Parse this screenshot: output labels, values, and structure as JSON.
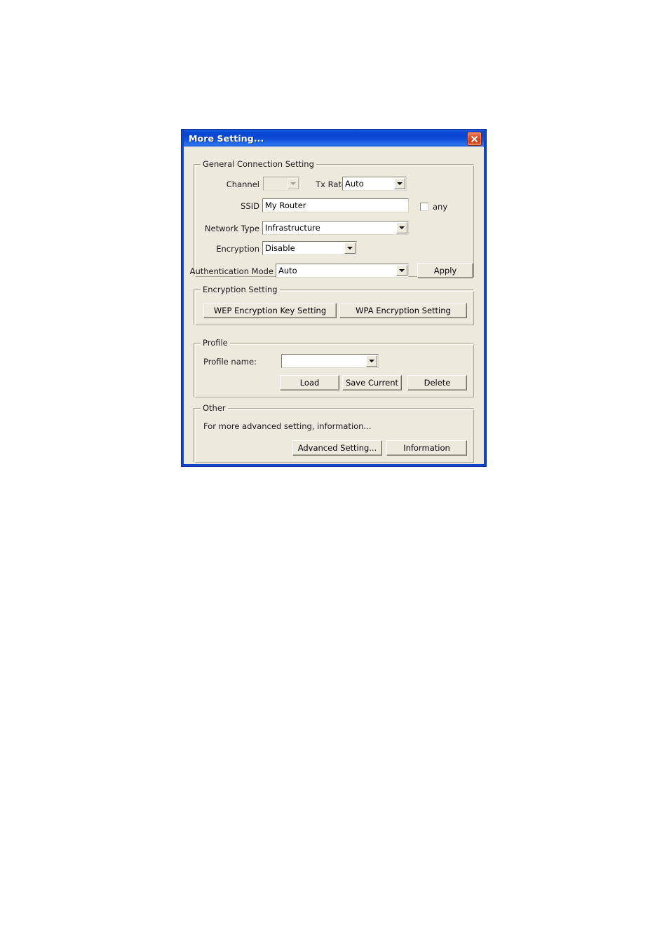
{
  "window": {
    "title": "More Setting...",
    "close_icon": "close-icon"
  },
  "general_group": {
    "title": "General Connection Setting",
    "channel": {
      "label": "Channel",
      "value": "",
      "disabled": true
    },
    "tx_rate": {
      "label": "Tx Rate",
      "value": "Auto"
    },
    "ssid": {
      "label": "SSID",
      "value": "My Router",
      "placeholder": ""
    },
    "any": {
      "label": "any",
      "checked": false
    },
    "network_type": {
      "label": "Network Type",
      "value": "Infrastructure"
    },
    "encryption": {
      "label": "Encryption",
      "value": "Disable"
    },
    "authentication_mode": {
      "label": "Authentication Mode",
      "value": "Auto"
    },
    "apply_label": "Apply"
  },
  "encryption_group": {
    "title": "Encryption Setting",
    "wep_label": "WEP Encryption Key Setting",
    "wpa_label": "WPA Encryption Setting"
  },
  "profile_group": {
    "title": "Profile",
    "profile_name_label": "Profile name:",
    "profile_name_value": "",
    "load_label": "Load",
    "save_current_label": "Save Current",
    "delete_label": "Delete"
  },
  "other_group": {
    "title": "Other",
    "description": "For more advanced setting, information...",
    "advanced_setting_label": "Advanced Setting...",
    "information_label": "Information"
  },
  "colors": {
    "titlebar_blue": "#0a46d2",
    "frame_blue": "#1344c4",
    "dialog_face": "#ece9dd",
    "close_red": "#cf3b12"
  }
}
